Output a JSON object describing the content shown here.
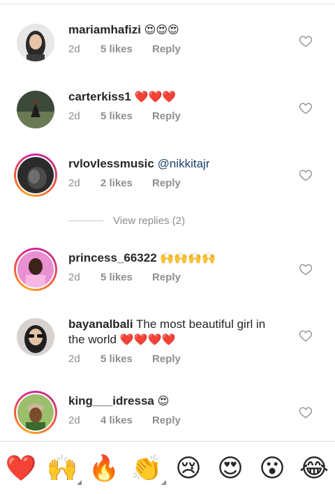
{
  "comments": [
    {
      "username": "mariamhafizi",
      "text": "",
      "emoji": "😍😍😍",
      "mention": "",
      "time": "2d",
      "likes": "5 likes",
      "reply": "Reply",
      "text2": ""
    },
    {
      "username": "carterkiss1",
      "text": "",
      "emoji": "❤️❤️❤️",
      "mention": "",
      "time": "2d",
      "likes": "5 likes",
      "reply": "Reply",
      "text2": ""
    },
    {
      "username": "rvlovlessmusic",
      "text": "",
      "emoji": "",
      "mention": "@nikkitajr",
      "time": "2d",
      "likes": "2 likes",
      "reply": "Reply",
      "text2": ""
    },
    {
      "username": "princess_66322",
      "text": "",
      "emoji": "🙌🙌🙌🙌",
      "mention": "",
      "time": "2d",
      "likes": "5 likes",
      "reply": "Reply",
      "text2": ""
    },
    {
      "username": "bayanalbali",
      "text": "The most beautiful girl in",
      "emoji": "❤️❤️❤️❤️",
      "mention": "",
      "time": "2d",
      "likes": "5 likes",
      "reply": "Reply",
      "text2": "the world"
    },
    {
      "username": "king___idressa",
      "text": "",
      "emoji": "😍",
      "mention": "",
      "time": "2d",
      "likes": "4 likes",
      "reply": "Reply",
      "text2": ""
    }
  ],
  "view_replies": "View replies (2)",
  "emoji_bar": [
    "❤️",
    "🙌",
    "🔥",
    "👏",
    "😢",
    "😍",
    "😮",
    "😂"
  ],
  "colors": {
    "heart_red": "#ed4956",
    "meta_gray": "#8e8e8e",
    "mention_blue": "#1c3f6e"
  }
}
